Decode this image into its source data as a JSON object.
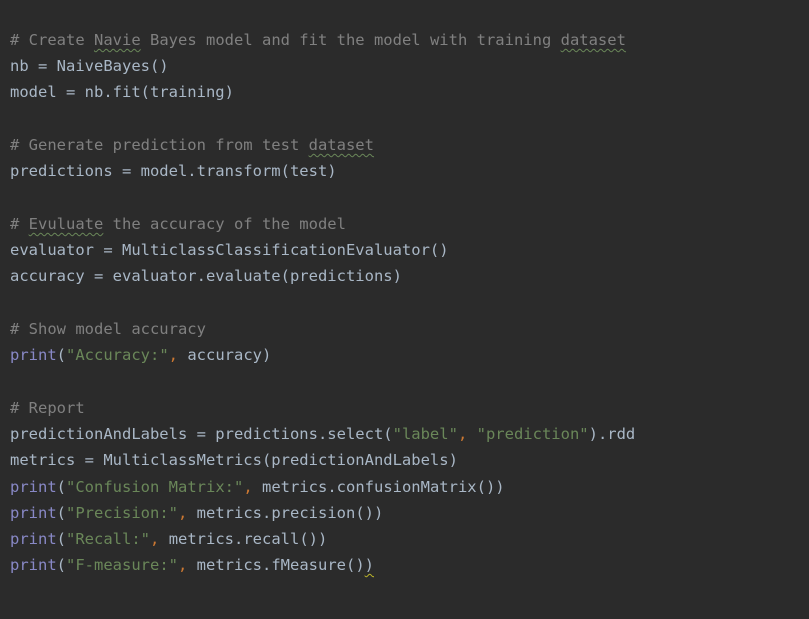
{
  "editor": {
    "colors": {
      "background": "#2b2b2b",
      "text": "#a9b7c6",
      "comment": "#808080",
      "builtin": "#8888c6",
      "string": "#6a8759",
      "comma": "#cc7832"
    },
    "code": {
      "c1": [
        "# Create ",
        "Navie",
        " Bayes model and fit the model with training ",
        "dataset"
      ],
      "l2": "nb = NaiveBayes()",
      "l3": "model = nb.fit(training)",
      "c5": [
        "# Generate prediction from test ",
        "dataset"
      ],
      "l6": "predictions = model.transform(test)",
      "c8": [
        "# ",
        "Evuluate",
        " the accuracy of the model"
      ],
      "l9": "evaluator = MulticlassClassificationEvaluator()",
      "l10": "accuracy = evaluator.evaluate(predictions)",
      "c12": "# Show model accuracy",
      "p13": {
        "fn": "print",
        "open": "(",
        "s": "\"Accuracy:\"",
        "comma": ",",
        "rest": " accuracy)"
      },
      "c15": "# Report",
      "l16": {
        "a": "predictionAndLabels = predictions.select(",
        "s1": "\"label\"",
        "comma": ",",
        "sp": " ",
        "s2": "\"prediction\"",
        "b": ").rdd"
      },
      "l17": "metrics = MulticlassMetrics(predictionAndLabels)",
      "p18": {
        "fn": "print",
        "open": "(",
        "s": "\"Confusion Matrix:\"",
        "comma": ",",
        "rest": " metrics.confusionMatrix())"
      },
      "p19": {
        "fn": "print",
        "open": "(",
        "s": "\"Precision:\"",
        "comma": ",",
        "rest": " metrics.precision())"
      },
      "p20": {
        "fn": "print",
        "open": "(",
        "s": "\"Recall:\"",
        "comma": ",",
        "rest": " metrics.recall())"
      },
      "p21": {
        "fn": "print",
        "open": "(",
        "s": "\"F-measure:\"",
        "comma": ",",
        "rest": " metrics.fMeasure()",
        "last": ")"
      }
    }
  }
}
